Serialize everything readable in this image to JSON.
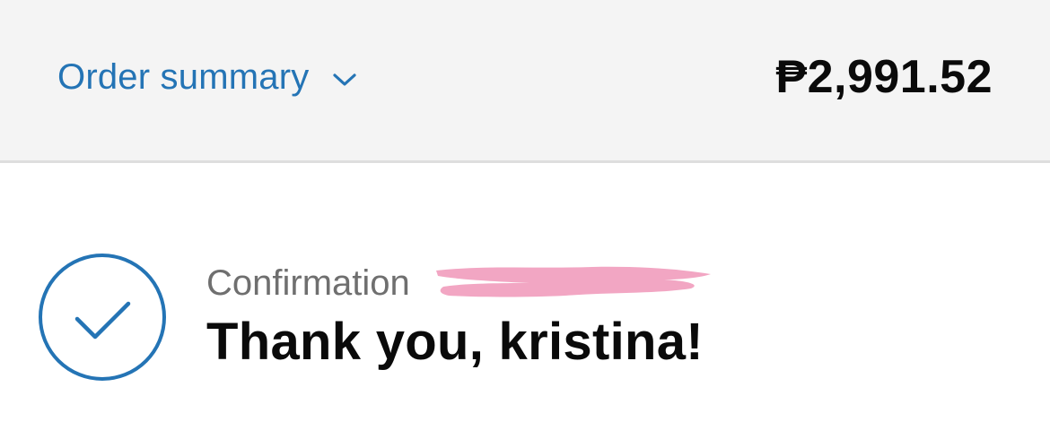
{
  "header": {
    "summary_label": "Order summary",
    "summary_toggle_icon": "chevron-down-icon",
    "total": "₱2,991.52"
  },
  "confirmation": {
    "status_icon": "checkmark-circle-icon",
    "label": "Confirmation",
    "redacted_number_marker": "pink-scribble-redaction",
    "greeting": "Thank you, kristina!"
  },
  "colors": {
    "accent": "#2474b5",
    "header_bg": "#f4f4f4",
    "redaction": "#f2a6c3",
    "text_primary": "#0a0a0a",
    "text_secondary": "#6f6f6f"
  }
}
